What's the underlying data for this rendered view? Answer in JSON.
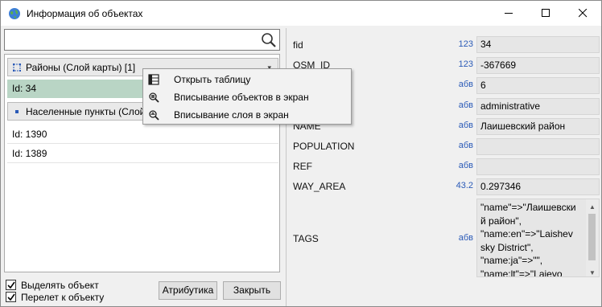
{
  "window": {
    "title": "Информация об объектах"
  },
  "left_panel": {
    "search": {
      "value": "",
      "placeholder": ""
    },
    "layers": [
      {
        "label": "Районы (Слой карты) [1]"
      },
      {
        "label": "Населенные пункты (Слой"
      }
    ],
    "objects": {
      "selected": "Id: 34",
      "list": [
        "Id: 1390",
        "Id: 1389"
      ]
    },
    "checkboxes": [
      {
        "label": "Выделять объект",
        "checked": true
      },
      {
        "label": "Перелет к объекту",
        "checked": true
      }
    ],
    "buttons": {
      "attributes": "Атрибутика",
      "close": "Закрыть"
    }
  },
  "context_menu": {
    "items": [
      {
        "label": "Открыть таблицу",
        "icon": "table-icon"
      },
      {
        "label": "Вписывание объектов в экран",
        "icon": "zoom-objects-icon"
      },
      {
        "label": "Вписывание слоя в экран",
        "icon": "zoom-layer-icon"
      }
    ]
  },
  "attributes": {
    "rows": [
      {
        "name": "fid",
        "type": "123",
        "value": "34"
      },
      {
        "name": "OSM_ID",
        "type": "123",
        "value": "-367669"
      },
      {
        "name": "",
        "type": "абв",
        "value": "6"
      },
      {
        "name": "",
        "type": "абв",
        "value": "administrative"
      },
      {
        "name": "NAME",
        "type": "абв",
        "value": "Лаишевский район"
      },
      {
        "name": "POPULATION",
        "type": "абв",
        "value": ""
      },
      {
        "name": "REF",
        "type": "абв",
        "value": ""
      },
      {
        "name": "WAY_AREA",
        "type": "43.2",
        "value": "0.297346"
      }
    ],
    "tags": {
      "name": "TAGS",
      "type": "абв",
      "value": "\"name\"=>\"Лаишевский район\",\n\"name:en\"=>\"Laishevsky District\",\n\"name:ja\"=>\"\",\n\"name:lt\"=>\"Laievo"
    }
  },
  "colors": {
    "selection": "#b9d5c5",
    "type_label": "#2a5ab7",
    "field_bg": "#e6e6e6"
  }
}
